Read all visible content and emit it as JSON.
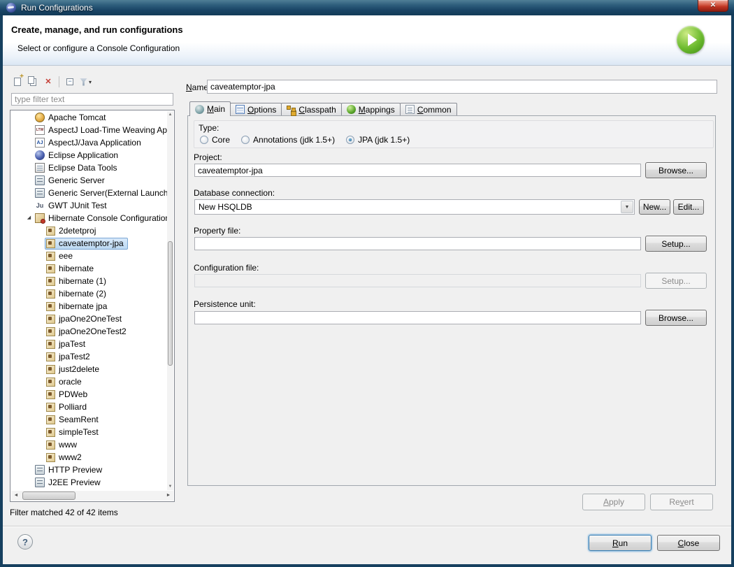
{
  "icons": {
    "close": "✕",
    "help": "?",
    "combo_arrow": "▼",
    "toolbar_dropdown_arrow": "▾",
    "expanded_twistie": "◢",
    "scroll_up": "▲",
    "scroll_down": "▼",
    "scroll_left": "◄",
    "scroll_right": "►"
  },
  "window": {
    "title": "Run Configurations"
  },
  "header": {
    "title": "Create, manage, and run configurations",
    "subtitle": "Select or configure a Console Configuration"
  },
  "sidebar": {
    "toolbar": [
      {
        "name": "new-configuration-button",
        "icon": "new-configuration-icon"
      },
      {
        "name": "duplicate-configuration-button",
        "icon": "duplicate-configuration-icon"
      },
      {
        "name": "delete-configuration-button",
        "icon": "delete-configuration-icon"
      },
      {
        "separator": true
      },
      {
        "name": "collapse-all-button",
        "icon": "collapse-all-icon"
      },
      {
        "name": "filter-button",
        "icon": "filter-icon",
        "has_dropdown": true
      }
    ],
    "filter_placeholder": "type filter text",
    "status": "Filter matched 42 of 42 items",
    "tree": [
      {
        "label": "Apache Tomcat",
        "icon": "tomcat-icon",
        "level": 0
      },
      {
        "label": "AspectJ Load-Time Weaving App",
        "icon": "aspectj-ltw-icon",
        "level": 0
      },
      {
        "label": "AspectJ/Java Application",
        "icon": "aspectj-java-icon",
        "level": 0
      },
      {
        "label": "Eclipse Application",
        "icon": "eclipse-app-icon",
        "level": 0
      },
      {
        "label": "Eclipse Data Tools",
        "icon": "data-tools-icon",
        "level": 0
      },
      {
        "label": "Generic Server",
        "icon": "server-icon",
        "level": 0
      },
      {
        "label": "Generic Server(External Launch)",
        "icon": "server-icon",
        "level": 0
      },
      {
        "label": "GWT JUnit Test",
        "icon": "junit-icon",
        "level": 0
      },
      {
        "label": "Hibernate Console Configuration",
        "icon": "hibernate-console-icon",
        "level": 0,
        "expanded": true
      },
      {
        "label": "2detetproj",
        "icon": "hibernate-config-icon",
        "level": 1
      },
      {
        "label": "caveatemptor-jpa",
        "icon": "hibernate-config-icon",
        "level": 1,
        "selected": true
      },
      {
        "label": "eee",
        "icon": "hibernate-config-icon",
        "level": 1
      },
      {
        "label": "hibernate",
        "icon": "hibernate-config-icon",
        "level": 1
      },
      {
        "label": "hibernate (1)",
        "icon": "hibernate-config-icon",
        "level": 1
      },
      {
        "label": "hibernate (2)",
        "icon": "hibernate-config-icon",
        "level": 1
      },
      {
        "label": "hibernate jpa",
        "icon": "hibernate-config-icon",
        "level": 1
      },
      {
        "label": "jpaOne2OneTest",
        "icon": "hibernate-config-icon",
        "level": 1
      },
      {
        "label": "jpaOne2OneTest2",
        "icon": "hibernate-config-icon",
        "level": 1
      },
      {
        "label": "jpaTest",
        "icon": "hibernate-config-icon",
        "level": 1
      },
      {
        "label": "jpaTest2",
        "icon": "hibernate-config-icon",
        "level": 1
      },
      {
        "label": "just2delete",
        "icon": "hibernate-config-icon",
        "level": 1
      },
      {
        "label": "oracle",
        "icon": "hibernate-config-icon",
        "level": 1
      },
      {
        "label": "PDWeb",
        "icon": "hibernate-config-icon",
        "level": 1
      },
      {
        "label": "Polliard",
        "icon": "hibernate-config-icon",
        "level": 1
      },
      {
        "label": "SeamRent",
        "icon": "hibernate-config-icon",
        "level": 1
      },
      {
        "label": "simpleTest",
        "icon": "hibernate-config-icon",
        "level": 1
      },
      {
        "label": "www",
        "icon": "hibernate-config-icon",
        "level": 1
      },
      {
        "label": "www2",
        "icon": "hibernate-config-icon",
        "level": 1
      },
      {
        "label": "HTTP Preview",
        "icon": "server-icon",
        "level": 0
      },
      {
        "label": "J2EE Preview",
        "icon": "server-icon",
        "level": 0
      }
    ]
  },
  "content": {
    "name_label": "Name:",
    "name_mnemonic": "N",
    "name_value": "caveatemptor-jpa",
    "tabs": [
      {
        "label": "Main",
        "mnemonic": "M",
        "icon": "main-tab-icon",
        "active": true
      },
      {
        "label": "Options",
        "mnemonic": "O",
        "icon": "options-tab-icon",
        "active": false
      },
      {
        "label": "Classpath",
        "mnemonic": "C",
        "icon": "classpath-tab-icon",
        "active": false
      },
      {
        "label": "Mappings",
        "mnemonic": "M",
        "icon": "mappings-tab-icon",
        "active": false
      },
      {
        "label": "Common",
        "mnemonic": "C",
        "icon": "common-tab-icon",
        "active": false
      }
    ],
    "type_group": {
      "label": "Type:",
      "options": [
        {
          "label": "Core",
          "selected": false
        },
        {
          "label": "Annotations (jdk 1.5+)",
          "selected": false
        },
        {
          "label": "JPA (jdk 1.5+)",
          "selected": true
        }
      ]
    },
    "project": {
      "label": "Project:",
      "value": "caveatemptor-jpa",
      "button": "Browse..."
    },
    "database_connection": {
      "label": "Database connection:",
      "value": "New HSQLDB",
      "new_button": "New...",
      "edit_button": "Edit..."
    },
    "property_file": {
      "label": "Property file:",
      "value": "",
      "button": "Setup..."
    },
    "configuration_file": {
      "label": "Configuration file:",
      "value": "",
      "button": "Setup..."
    },
    "persistence_unit": {
      "label": "Persistence unit:",
      "value": "",
      "button": "Browse..."
    },
    "apply_button": "Apply",
    "apply_mnemonic": "A",
    "revert_button": "Revert",
    "revert_mnemonic": "v"
  },
  "footer": {
    "run_button": "Run",
    "run_mnemonic": "R",
    "close_button": "Close",
    "close_mnemonic": "C"
  }
}
